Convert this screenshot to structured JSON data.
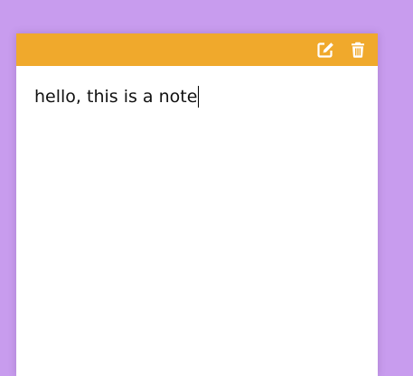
{
  "colors": {
    "background": "#c89cee",
    "header": "#f0a92c",
    "note": "#ffffff"
  },
  "note": {
    "text": "hello, this is a note",
    "icons": {
      "edit": "edit-icon",
      "delete": "trash-icon"
    }
  }
}
